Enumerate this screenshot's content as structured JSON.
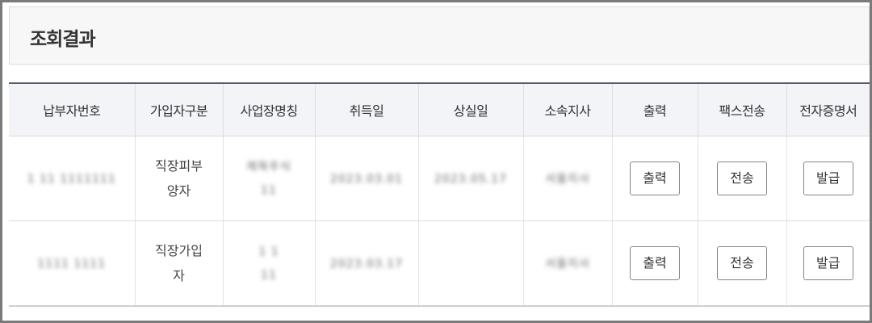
{
  "title": "조회결과",
  "columns": [
    "납부자번호",
    "가입자구분",
    "사업장명칭",
    "취득일",
    "상실일",
    "소속지사",
    "출력",
    "팩스전송",
    "전자증명서"
  ],
  "rows": [
    {
      "payer_no": "1 11 1111111",
      "subscriber_type": "직장피부양자",
      "workplace_name": [
        "제목주식",
        "11"
      ],
      "acquired_date": "2023.03.01",
      "lost_date": "2023.05.17",
      "branch": "서울지사",
      "print_label": "출력",
      "fax_label": "전송",
      "cert_label": "발급"
    },
    {
      "payer_no": "1111 1111",
      "subscriber_type": "직장가입자",
      "workplace_name": [
        "1 1",
        "11"
      ],
      "acquired_date": "2023.03.17",
      "lost_date": "",
      "branch": "서울지사",
      "print_label": "출력",
      "fax_label": "전송",
      "cert_label": "발급"
    }
  ]
}
